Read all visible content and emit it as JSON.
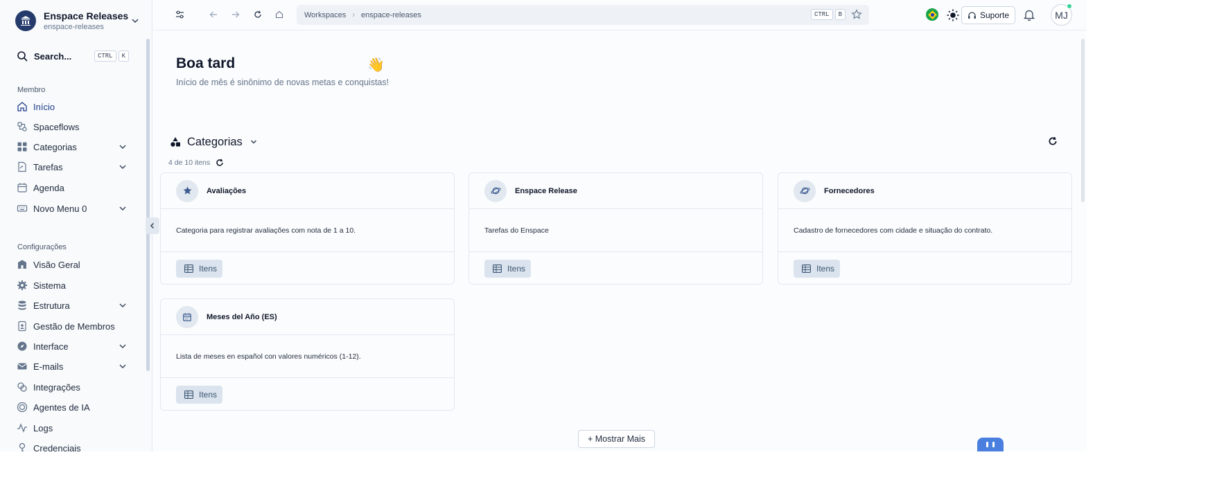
{
  "workspace": {
    "name": "Enspace Releases",
    "slug": "enspace-releases"
  },
  "search": {
    "label": "Search...",
    "kbd": [
      "CTRL",
      "K"
    ]
  },
  "sidebar": {
    "section_membro": "Membro",
    "membro_items": [
      {
        "label": "Início",
        "icon": "home-icon",
        "expandable": false,
        "active": true
      },
      {
        "label": "Spaceflows",
        "icon": "flow-icon",
        "expandable": false
      },
      {
        "label": "Categorias",
        "icon": "grid-icon",
        "expandable": true
      },
      {
        "label": "Tarefas",
        "icon": "file-icon",
        "expandable": true
      },
      {
        "label": "Agenda",
        "icon": "calendar-icon",
        "expandable": false
      },
      {
        "label": "Novo Menu 0",
        "icon": "keyboard-icon",
        "expandable": true
      }
    ],
    "section_config": "Configurações",
    "config_items": [
      {
        "label": "Visão Geral",
        "icon": "building-icon",
        "expandable": false
      },
      {
        "label": "Sistema",
        "icon": "gear-icon",
        "expandable": false
      },
      {
        "label": "Estrutura",
        "icon": "database-icon",
        "expandable": true
      },
      {
        "label": "Gestão de Membros",
        "icon": "id-badge-icon",
        "expandable": false
      },
      {
        "label": "Interface",
        "icon": "compass-icon",
        "expandable": true
      },
      {
        "label": "E-mails",
        "icon": "mail-icon",
        "expandable": true
      },
      {
        "label": "Integrações",
        "icon": "link-icon",
        "expandable": false
      },
      {
        "label": "Agentes de IA",
        "icon": "ai-icon",
        "expandable": false
      },
      {
        "label": "Logs",
        "icon": "activity-icon",
        "expandable": false
      },
      {
        "label": "Credenciais",
        "icon": "key-icon",
        "expandable": false
      }
    ]
  },
  "topbar": {
    "breadcrumb": [
      "Workspaces",
      "enspace-releases"
    ],
    "kbd": [
      "CTRL",
      "B"
    ],
    "support_label": "Suporte",
    "avatar_initials": "MJ"
  },
  "greeting": {
    "title": "Boa tard",
    "subtitle": "Início de mês é sinônimo de novas metas e conquistas!"
  },
  "categories": {
    "title": "Categorias",
    "count": "4 de 10 itens",
    "cards": [
      {
        "title": "Avaliações",
        "icon": "star-icon",
        "description": "Categoria para registrar avaliações com nota de 1 a 10.",
        "button": "Itens"
      },
      {
        "title": "Enspace Release",
        "icon": "planet-icon",
        "description": "Tarefas do Enspace",
        "button": "Itens"
      },
      {
        "title": "Fornecedores",
        "icon": "planet-icon",
        "description": "Cadastro de fornecedores com cidade e situação do contrato.",
        "button": "Itens"
      },
      {
        "title": "Meses del Año (ES)",
        "icon": "calendar-icon",
        "description": "Lista de meses en español con valores numéricos (1-12).",
        "button": "Itens"
      }
    ],
    "show_more": "+ Mostrar Mais"
  },
  "colors": {
    "brand": "#243b6b",
    "accent": "#3b82f6",
    "online": "#34d399"
  }
}
